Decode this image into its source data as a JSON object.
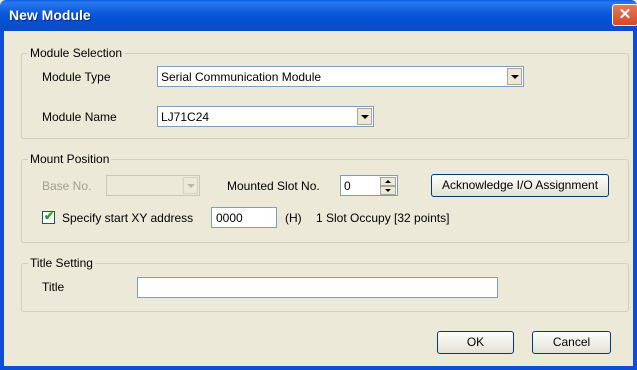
{
  "window": {
    "title": "New Module",
    "close_glyph": "✕"
  },
  "module_selection": {
    "legend": "Module Selection",
    "type_label": "Module Type",
    "type_value": "Serial Communication Module",
    "name_label": "Module Name",
    "name_value": "LJ71C24"
  },
  "mount_position": {
    "legend": "Mount Position",
    "base_label": "Base No.",
    "base_value": "",
    "slot_label": "Mounted Slot No.",
    "slot_value": "0",
    "ack_button": "Acknowledge I/O Assignment",
    "specify_label": "Specify start XY address",
    "specify_checked": true,
    "xy_value": "0000",
    "hex_suffix": "(H)",
    "occupy_text": "1 Slot Occupy [32 points]"
  },
  "title_setting": {
    "legend": "Title Setting",
    "title_label": "Title",
    "title_value": ""
  },
  "footer": {
    "ok_label": "OK",
    "cancel_label": "Cancel"
  },
  "icons": [
    "close-icon",
    "chevron-down-icon",
    "spin-up-icon",
    "spin-down-icon",
    "check-icon"
  ]
}
